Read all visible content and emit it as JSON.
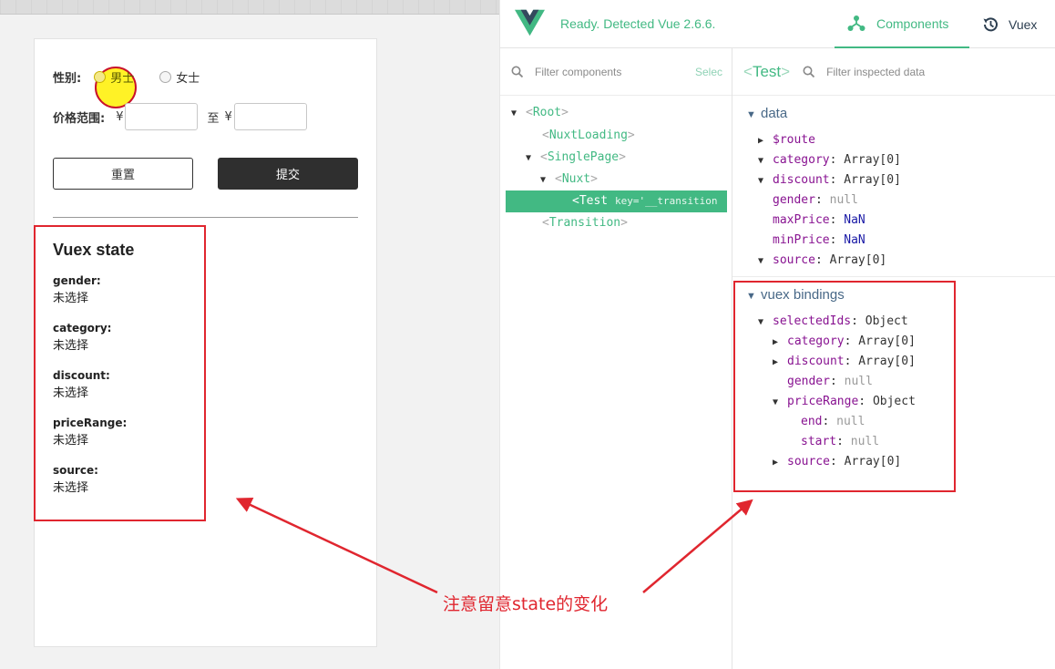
{
  "left": {
    "gender_label": "性别:",
    "gender_options": [
      "男士",
      "女士"
    ],
    "price_label": "价格范围:",
    "currency": "¥",
    "to_label": "至",
    "reset_label": "重置",
    "submit_label": "提交"
  },
  "vuex_state": {
    "title": "Vuex state",
    "items": [
      {
        "key": "gender:",
        "value": "未选择"
      },
      {
        "key": "category:",
        "value": "未选择"
      },
      {
        "key": "discount:",
        "value": "未选择"
      },
      {
        "key": "priceRange:",
        "value": "未选择"
      },
      {
        "key": "source:",
        "value": "未选择"
      }
    ]
  },
  "devtools": {
    "status": "Ready. Detected Vue 2.6.6.",
    "tabs": {
      "components": "Components",
      "vuex": "Vuex"
    },
    "filter_components_placeholder": "Filter components",
    "select_label": "Selec",
    "inspected_component": "Test",
    "filter_inspected_placeholder": "Filter inspected data",
    "tree": {
      "root": "Root",
      "nuxt_loading": "NuxtLoading",
      "single_page": "SinglePage",
      "nuxt": "Nuxt",
      "selected": "<Test",
      "selected_attr": "key='__transition",
      "transition": "Transition"
    },
    "data_section": {
      "title": "data",
      "props": [
        {
          "key": "$route",
          "sep": "",
          "value": "",
          "arrow": "▶"
        },
        {
          "key": "category",
          "sep": ": ",
          "value": "Array[0]",
          "arrow": "▼"
        },
        {
          "key": "discount",
          "sep": ": ",
          "value": "Array[0]",
          "arrow": "▼"
        },
        {
          "key": "gender",
          "sep": ": ",
          "value": "null",
          "arrow": ""
        },
        {
          "key": "maxPrice",
          "sep": ": ",
          "value": "NaN",
          "arrow": ""
        },
        {
          "key": "minPrice",
          "sep": ": ",
          "value": "NaN",
          "arrow": ""
        },
        {
          "key": "source",
          "sep": ": ",
          "value": "Array[0]",
          "arrow": "▼"
        }
      ]
    },
    "vuex_section": {
      "title": "vuex bindings",
      "props": [
        {
          "key": "selectedIds",
          "sep": ": ",
          "value": "Object",
          "arrow": "▼"
        },
        {
          "key": "category",
          "sep": ": ",
          "value": "Array[0]",
          "arrow": "▶"
        },
        {
          "key": "discount",
          "sep": ": ",
          "value": "Array[0]",
          "arrow": "▶"
        },
        {
          "key": "gender",
          "sep": ": ",
          "value": "null",
          "arrow": ""
        },
        {
          "key": "priceRange",
          "sep": ": ",
          "value": "Object",
          "arrow": "▼"
        },
        {
          "key": "end",
          "sep": ": ",
          "value": "null",
          "arrow": ""
        },
        {
          "key": "start",
          "sep": ": ",
          "value": "null",
          "arrow": ""
        },
        {
          "key": "source",
          "sep": ": ",
          "value": "Array[0]",
          "arrow": "▶"
        }
      ]
    }
  },
  "annotation": "注意留意state的变化",
  "colors": {
    "accent": "#42b983",
    "annotation_red": "#e0262f",
    "key_purple": "#881391"
  }
}
